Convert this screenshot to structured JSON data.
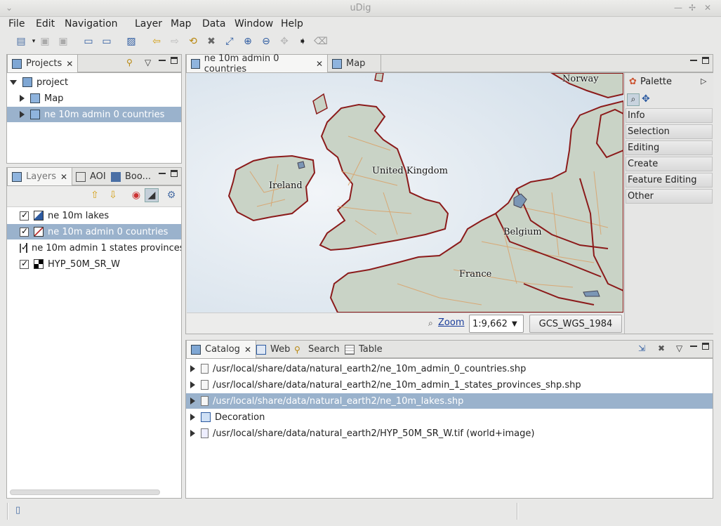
{
  "window": {
    "title": "uDig"
  },
  "menu": [
    "File",
    "Edit",
    "Navigation",
    "Layer",
    "Map",
    "Data",
    "Window",
    "Help"
  ],
  "projects_view": {
    "tab_label": "Projects",
    "tree": [
      {
        "label": "project",
        "expanded": true
      },
      {
        "label": "Map"
      },
      {
        "label": "ne 10m admin 0 countries",
        "selected": true
      }
    ]
  },
  "layers_view": {
    "tabs": [
      "Layers",
      "AOI",
      "Boo..."
    ],
    "layers": [
      {
        "label": "ne 10m lakes",
        "checked": true
      },
      {
        "label": "ne 10m admin 0 countries",
        "checked": true,
        "selected": true
      },
      {
        "label": "ne 10m admin 1 states provinces",
        "checked": true
      },
      {
        "label": "HYP_50M_SR_W",
        "checked": true
      }
    ]
  },
  "editor": {
    "tabs": [
      "ne 10m admin 0 countries",
      "Map"
    ],
    "map_labels": [
      "Norway",
      "United Kingdom",
      "Ireland",
      "Belgium",
      "France"
    ],
    "zoom_label": "Zoom",
    "scale_value": "1:9,662,",
    "crs_label": "GCS_WGS_1984"
  },
  "palette": {
    "title": "Palette",
    "sections": [
      "Info",
      "Selection",
      "Editing",
      "Create",
      "Feature Editing",
      "Other"
    ]
  },
  "catalog_view": {
    "tabs": [
      "Catalog",
      "Web",
      "Search",
      "Table"
    ],
    "items": [
      {
        "label": "/usr/local/share/data/natural_earth2/ne_10m_admin_0_countries.shp"
      },
      {
        "label": "/usr/local/share/data/natural_earth2/ne_10m_admin_1_states_provinces_shp.shp"
      },
      {
        "label": "/usr/local/share/data/natural_earth2/ne_10m_lakes.shp",
        "selected": true
      },
      {
        "label": "Decoration"
      },
      {
        "label": "/usr/local/share/data/natural_earth2/HYP_50M_SR_W.tif (world+image)"
      }
    ]
  },
  "colors": {
    "selection": "#9ab2cc",
    "border_country": "#8b1a1a",
    "border_state": "#d9a36b",
    "land": "#c8d2c8",
    "sea": "#dfe8f0"
  }
}
